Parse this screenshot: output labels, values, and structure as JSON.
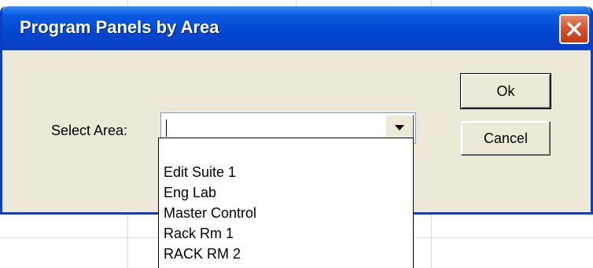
{
  "dialog": {
    "title": "Program Panels by Area",
    "close_icon": "close-icon"
  },
  "form": {
    "label": "Select Area:",
    "combo_value": "",
    "dropdown_icon": "chevron-down-icon"
  },
  "buttons": {
    "ok": "Ok",
    "cancel": "Cancel"
  },
  "dropdown": {
    "items": [
      "Edit Suite 1",
      "Eng Lab",
      "Master Control",
      "Rack Rm 1",
      "RACK RM 2"
    ]
  },
  "colors": {
    "titlebar": "#0a5be0",
    "dialog_bg": "#ece9d8",
    "close_button": "#d6502a"
  }
}
